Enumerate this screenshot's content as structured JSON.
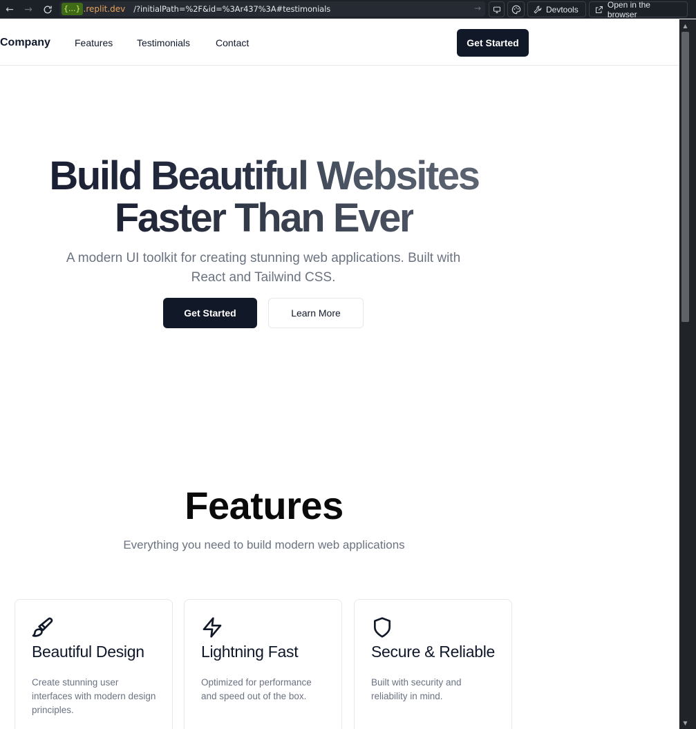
{
  "browser": {
    "url_tag": "{...}",
    "url_domain": ".replit.dev",
    "url_path": "/?initialPath=%2F&id=%3Ar437%3A#testimonials",
    "devtools_label": "Devtools",
    "open_browser_label": "Open in the browser"
  },
  "header": {
    "brand": "Company",
    "nav": [
      "Features",
      "Testimonials",
      "Contact"
    ],
    "cta": "Get Started"
  },
  "hero": {
    "title_line1_a": "Build Beautiful Websites",
    "title_line2": "Faster Than Ever",
    "subtitle": "A modern UI toolkit for creating stunning web applications. Built with React and Tailwind CSS.",
    "primary_button": "Get Started",
    "secondary_button": "Learn More"
  },
  "features": {
    "title": "Features",
    "subtitle": "Everything you need to build modern web applications",
    "cards": [
      {
        "icon": "paintbrush-icon",
        "title": "Beautiful Design",
        "description": "Create stunning user interfaces with modern design principles."
      },
      {
        "icon": "lightning-icon",
        "title": "Lightning Fast",
        "description": "Optimized for performance and speed out of the box."
      },
      {
        "icon": "shield-icon",
        "title": "Secure & Reliable",
        "description": "Built with security and reliability in mind."
      }
    ]
  },
  "colors": {
    "primary": "#111827",
    "muted_text": "#6b7280",
    "border": "#e5e7eb"
  }
}
